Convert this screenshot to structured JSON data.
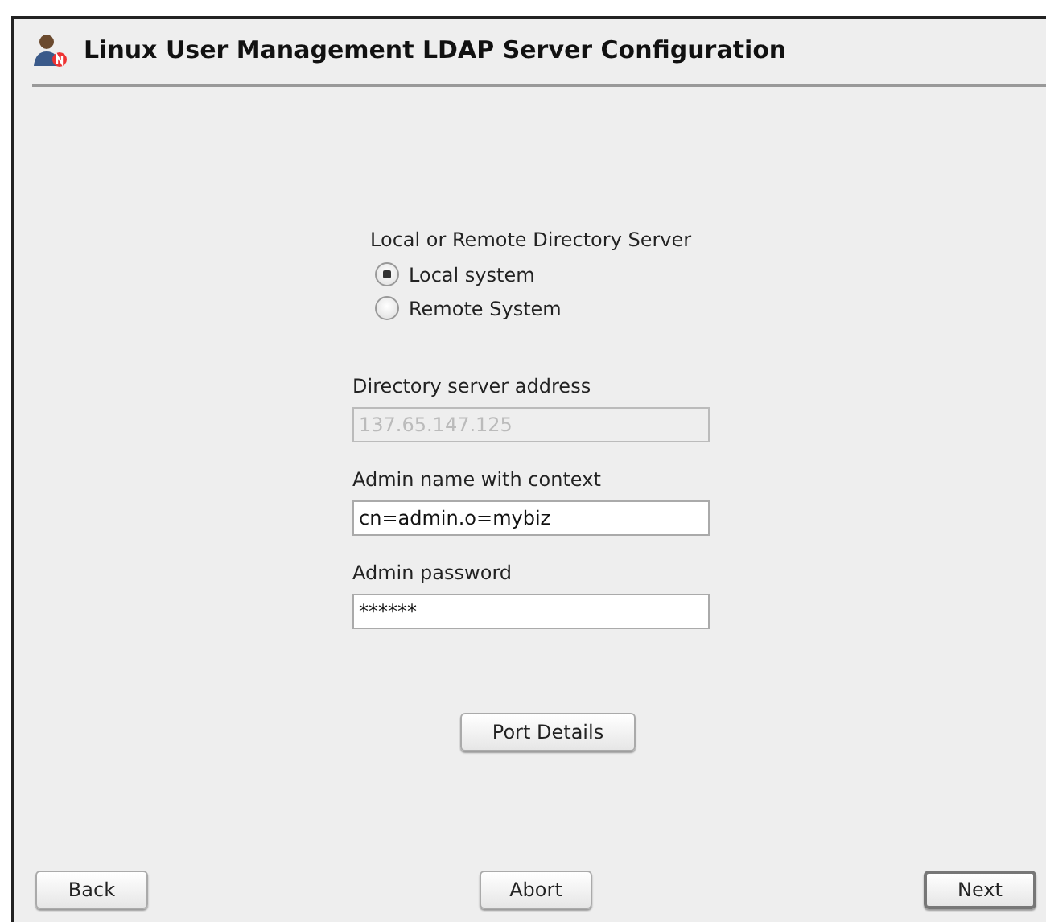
{
  "window": {
    "title": "Linux User Management LDAP Server Configuration"
  },
  "server_type": {
    "label": "Local or Remote Directory Server",
    "options": [
      {
        "label": "Local system",
        "selected": true
      },
      {
        "label": "Remote System",
        "selected": false
      }
    ]
  },
  "fields": [
    {
      "label": "Directory server address",
      "value": "137.65.147.125",
      "disabled": true
    },
    {
      "label": "Admin name with context",
      "value": "cn=admin.o=mybiz",
      "disabled": false
    },
    {
      "label": "Admin password",
      "value": "******",
      "disabled": false
    }
  ],
  "port_button": "Port Details",
  "buttons": [
    {
      "label": "Back",
      "default": false
    },
    {
      "label": "Abort",
      "default": false
    },
    {
      "label": "Next",
      "default": true
    }
  ]
}
